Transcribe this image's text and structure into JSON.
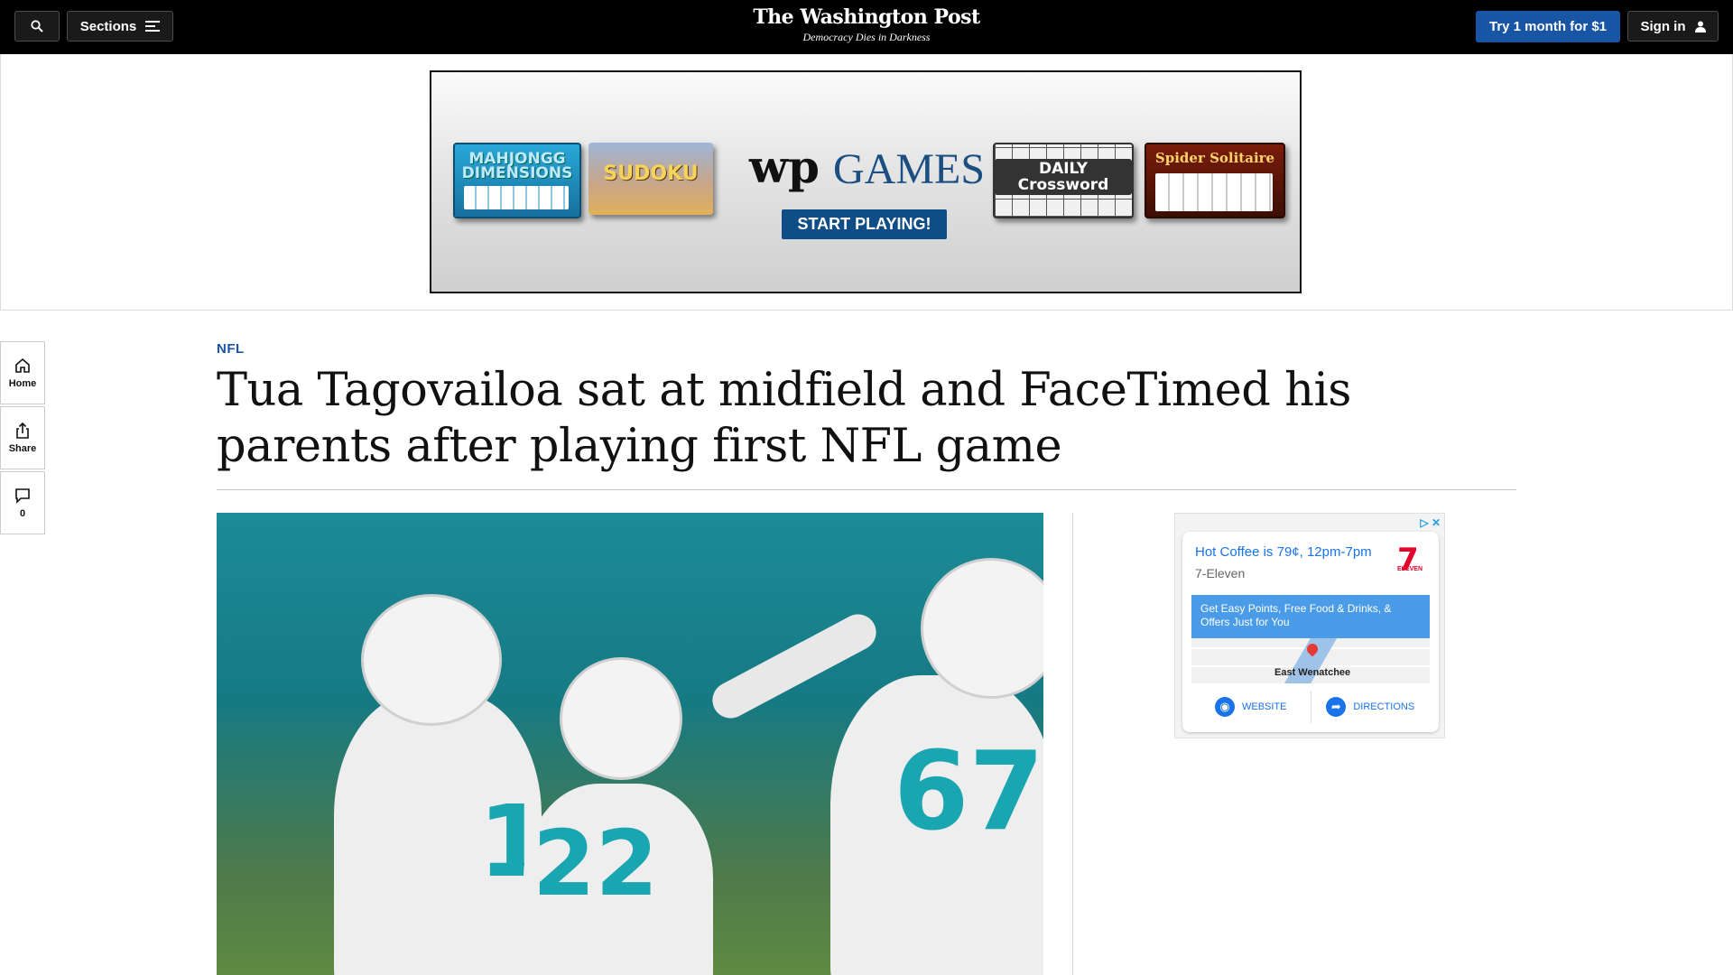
{
  "header": {
    "sections_label": "Sections",
    "logo": "The Washington Post",
    "tagline": "Democracy Dies in Darkness",
    "subscribe_label": "Try 1 month for $1",
    "signin_label": "Sign in"
  },
  "top_ad": {
    "games": [
      "MAHJONGG DIMENSIONS",
      "SUDOKU",
      "DAILY Crossword",
      "Spider Solitaire"
    ],
    "brand_logo": "wp",
    "brand_name": "GAMES",
    "cta": "START PLAYING!"
  },
  "rail": {
    "home_label": "Home",
    "share_label": "Share",
    "comments_count": "0"
  },
  "article": {
    "kicker": "NFL",
    "headline": "Tua Tagovailoa sat at midfield and FaceTimed his parents after playing first NFL game",
    "photo_numbers": [
      "1",
      "22",
      "67"
    ]
  },
  "side_ad": {
    "title": "Hot Coffee is 79¢, 12pm-7pm",
    "advertiser": "7-Eleven",
    "brand_mark": "7",
    "brand_word": "ELEVEN",
    "offer": "Get Easy Points, Free Food & Drinks, & Offers Just for You",
    "map_place": "East Wenatchee",
    "website_label": "WEBSITE",
    "directions_label": "DIRECTIONS"
  },
  "colors": {
    "nav_bg": "#000000",
    "subscribe_blue": "#1955a5",
    "kicker_blue": "#1955a5",
    "ad_link_blue": "#1a73e8"
  }
}
